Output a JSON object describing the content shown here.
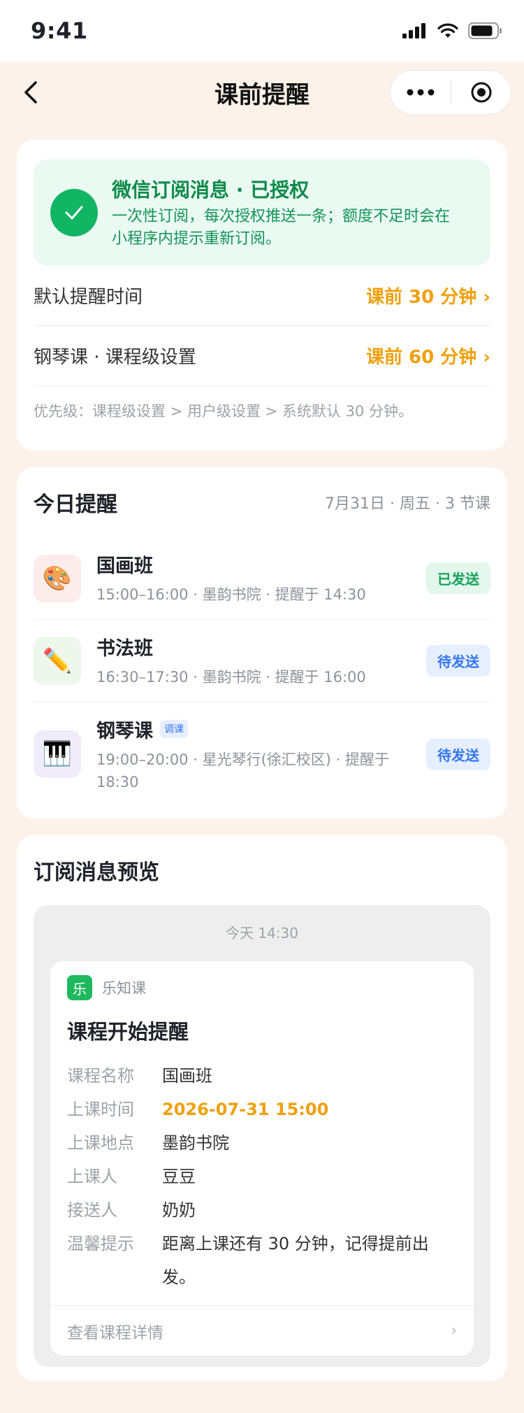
{
  "status_bar": {
    "time": "9:41"
  },
  "nav": {
    "title": "课前提醒"
  },
  "auth": {
    "title": "微信订阅消息 · 已授权",
    "desc": "一次性订阅，每次授权推送一条；额度不足时会在小程序内提示重新订阅。"
  },
  "settings": {
    "default_label": "默认提醒时间",
    "default_value": "课前 30 分钟 ›",
    "course_label": "钢琴课 · 课程级设置",
    "course_value": "课前 60 分钟 ›",
    "priority_note": "优先级：课程级设置 > 用户级设置 > 系统默认 30 分钟。"
  },
  "today": {
    "title": "今日提醒",
    "meta": "7月31日 · 周五 · 3 节课",
    "lessons": [
      {
        "icon": "🎨",
        "name": "国画班",
        "tag": "",
        "sub": "15:00–16:00 · 墨韵书院 · 提醒于 14:30",
        "status": "已发送",
        "icon_bg": "#fdecec"
      },
      {
        "icon": "✏️",
        "name": "书法班",
        "tag": "",
        "sub": "16:30–17:30 · 墨韵书院 · 提醒于 16:00",
        "status": "待发送",
        "icon_bg": "#edf7ec"
      },
      {
        "icon": "🎹",
        "name": "钢琴课",
        "tag": "调课",
        "sub": "19:00–20:00 · 星光琴行(徐汇校区) · 提醒于 18:30",
        "status": "待发送",
        "icon_bg": "#f1ecf9"
      }
    ]
  },
  "preview": {
    "title": "订阅消息预览",
    "time": "今天 14:30",
    "app_logo": "乐",
    "app_name": "乐知课",
    "msg_title": "课程开始提醒",
    "rows": [
      {
        "key": "课程名称",
        "value": "国画班"
      },
      {
        "key": "上课时间",
        "value": "2026-07-31 15:00"
      },
      {
        "key": "上课地点",
        "value": "墨韵书院"
      },
      {
        "key": "上课人",
        "value": "豆豆"
      },
      {
        "key": "接送人",
        "value": "奶奶"
      },
      {
        "key": "温馨提示",
        "value": "距离上课还有 30 分钟，记得提前出发。"
      }
    ],
    "footer_link": "查看课程详情",
    "footer_arrow": "›"
  },
  "colors": {
    "accent_orange": "#f0a00e",
    "success_green": "#12b564",
    "info_blue": "#3577f0",
    "page_bg": "#fdf2ea"
  }
}
